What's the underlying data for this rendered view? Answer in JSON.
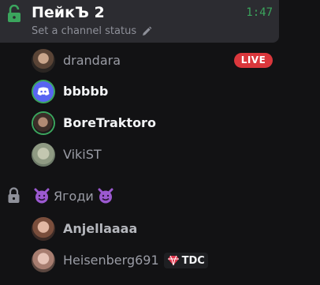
{
  "active_channel": {
    "name": "ПейкЪ 2",
    "timer": "1:47",
    "status_placeholder": "Set a channel status"
  },
  "voice_users": [
    {
      "name": "drandara",
      "badge": "LIVE"
    },
    {
      "name": "bbbbb"
    },
    {
      "name": "BoreTraktoro"
    },
    {
      "name": "VikiST"
    }
  ],
  "second_channel": {
    "name": "Ягоди",
    "emoji_left": "😈",
    "emoji_right": "😈"
  },
  "second_users": [
    {
      "name": "Anjellaaaa"
    },
    {
      "name": "Heisenberg691",
      "tag": "TDC"
    }
  ],
  "colors": {
    "live": "#da373c",
    "speaking": "#3ba55d",
    "lock_active": "#3ba55d",
    "lock_inactive": "#8e9099",
    "tdc_gem": "#e0364d"
  }
}
